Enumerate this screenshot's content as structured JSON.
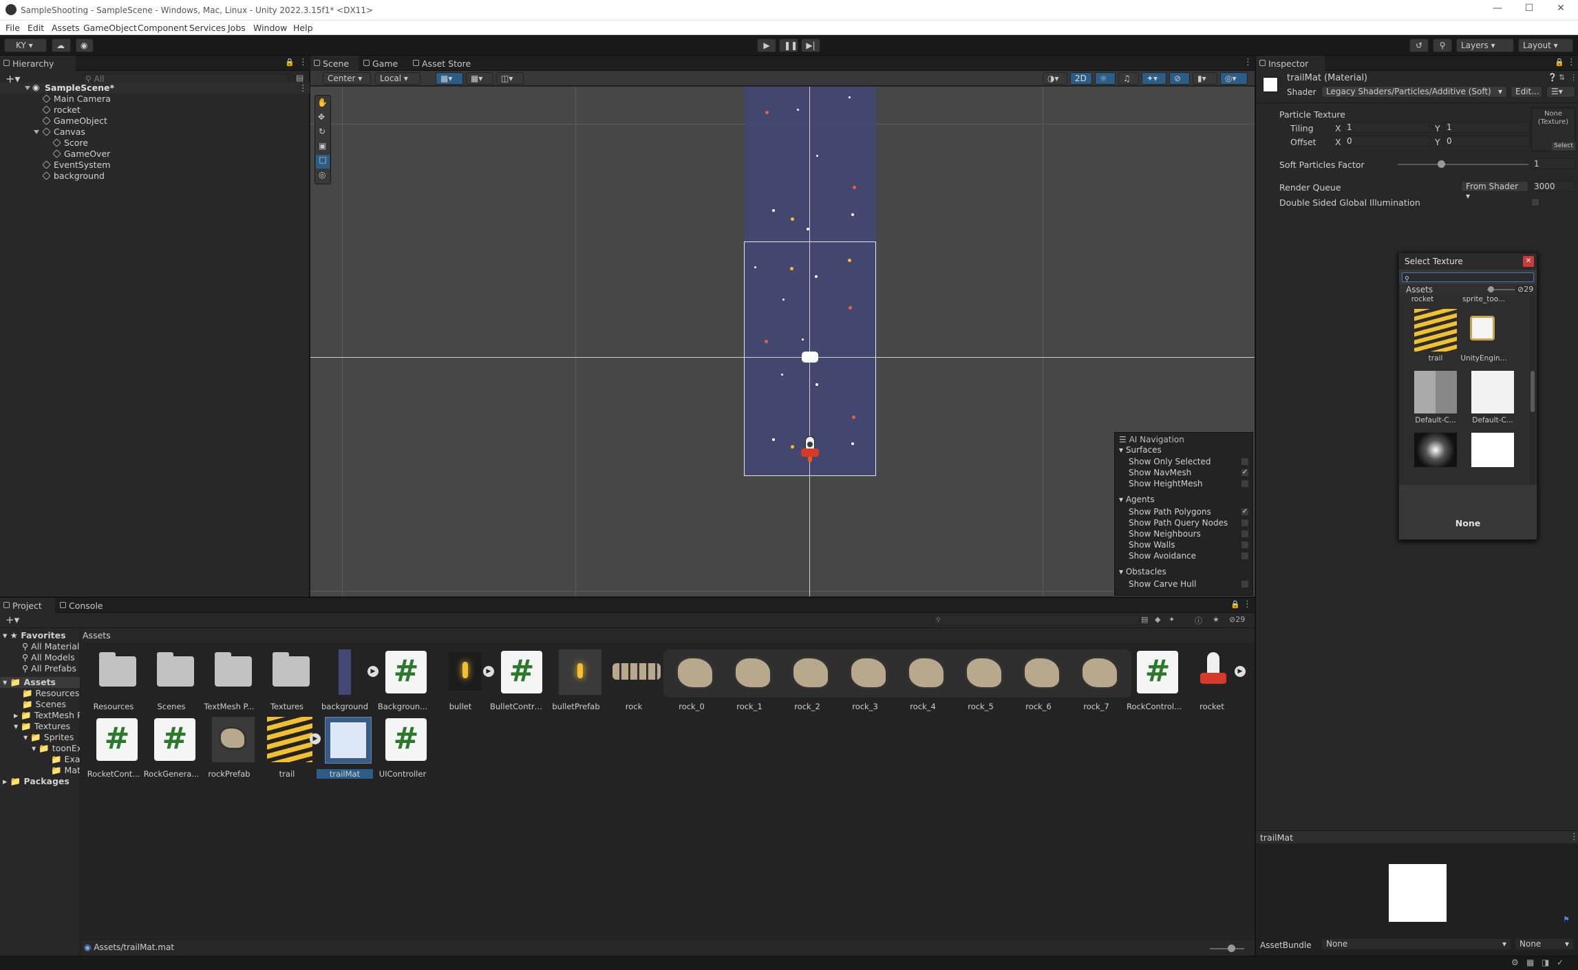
{
  "window": {
    "title": "SampleShooting - SampleScene - Windows, Mac, Linux - Unity 2022.3.15f1* <DX11>"
  },
  "menu": [
    "File",
    "Edit",
    "Assets",
    "GameObject",
    "Component",
    "Services",
    "Jobs",
    "Window",
    "Help"
  ],
  "toolbar": {
    "account": "KY",
    "layers": "Layers",
    "layout": "Layout"
  },
  "hierarchy": {
    "tab": "Hierarchy",
    "search_placeholder": "All",
    "scene": "SampleScene*",
    "items": [
      "Main Camera",
      "rocket",
      "GameObject",
      "Canvas",
      "Score",
      "GameOver",
      "EventSystem",
      "background"
    ]
  },
  "scene_tabs": [
    "Scene",
    "Game",
    "Asset Store"
  ],
  "scene_toolbar": {
    "pivot": "Center",
    "space": "Local",
    "mode2d": "2D"
  },
  "ai_navigation": {
    "title": "AI Navigation",
    "surfaces": "Surfaces",
    "surface_items": [
      {
        "label": "Show Only Selected",
        "checked": false
      },
      {
        "label": "Show NavMesh",
        "checked": true
      },
      {
        "label": "Show HeightMesh",
        "checked": false
      }
    ],
    "agents": "Agents",
    "agent_items": [
      {
        "label": "Show Path Polygons",
        "checked": true
      },
      {
        "label": "Show Path Query Nodes",
        "checked": false
      },
      {
        "label": "Show Neighbours",
        "checked": false
      },
      {
        "label": "Show Walls",
        "checked": false
      },
      {
        "label": "Show Avoidance",
        "checked": false
      }
    ],
    "obstacles": "Obstacles",
    "obstacle_items": [
      {
        "label": "Show Carve Hull",
        "checked": false
      }
    ]
  },
  "inspector": {
    "tab": "Inspector",
    "material_name": "trailMat (Material)",
    "shader_label": "Shader",
    "shader_value": "Legacy Shaders/Particles/Additive (Soft)",
    "edit_button": "Edit...",
    "particle_texture": "Particle Texture",
    "texture_none": "None\n(Texture)",
    "select_button": "Select",
    "tiling": "Tiling",
    "offset": "Offset",
    "x": "X",
    "y": "Y",
    "tiling_x": "1",
    "tiling_y": "1",
    "offset_x": "0",
    "offset_y": "0",
    "soft_particles": "Soft Particles Factor",
    "soft_particles_value": "1",
    "soft_particles_level": 0.33,
    "render_queue": "Render Queue",
    "render_queue_mode": "From Shader",
    "render_queue_value": "3000",
    "double_sided": "Double Sided Global Illumination",
    "preview_name": "trailMat",
    "assetbundle_label": "AssetBundle",
    "assetbundle_value": "None",
    "assetbundle_variant": "None"
  },
  "select_texture": {
    "title": "Select Texture",
    "assets_label": "Assets",
    "count": "29",
    "top_labels": [
      "rocket",
      "sprite_too..."
    ],
    "items": [
      "trail",
      "UnityEngin...",
      "Default-C...",
      "Default-C..."
    ],
    "none_label": "None"
  },
  "project": {
    "tabs": [
      "Project",
      "Console"
    ],
    "count": "29",
    "favorites": "Favorites",
    "favorite_items": [
      "All Materials",
      "All Models",
      "All Prefabs"
    ],
    "assets_root": "Assets",
    "tree": [
      "Resources",
      "Scenes",
      "TextMesh P",
      "Textures",
      "Sprites",
      "toonEx",
      "Exar",
      "Mate"
    ],
    "packages": "Packages",
    "breadcrumb": "Assets",
    "row1": [
      "Resources",
      "Scenes",
      "TextMesh P...",
      "Textures",
      "background",
      "Backgroun...",
      "bullet",
      "BulletContro...",
      "bulletPrefab",
      "rock",
      "rock_0",
      "rock_1",
      "rock_2",
      "rock_3",
      "rock_4",
      "rock_5",
      "rock_6",
      "rock_7",
      "RockControl...",
      "rocket"
    ],
    "row2": [
      "RocketCont...",
      "RockGenera...",
      "rockPrefab",
      "trail",
      "trailMat",
      "UIController"
    ],
    "status_path": "Assets/trailMat.mat"
  },
  "colors": {
    "accent": "#2c5d87",
    "scene_bg": "#474747",
    "camera_bg": "#434773"
  }
}
